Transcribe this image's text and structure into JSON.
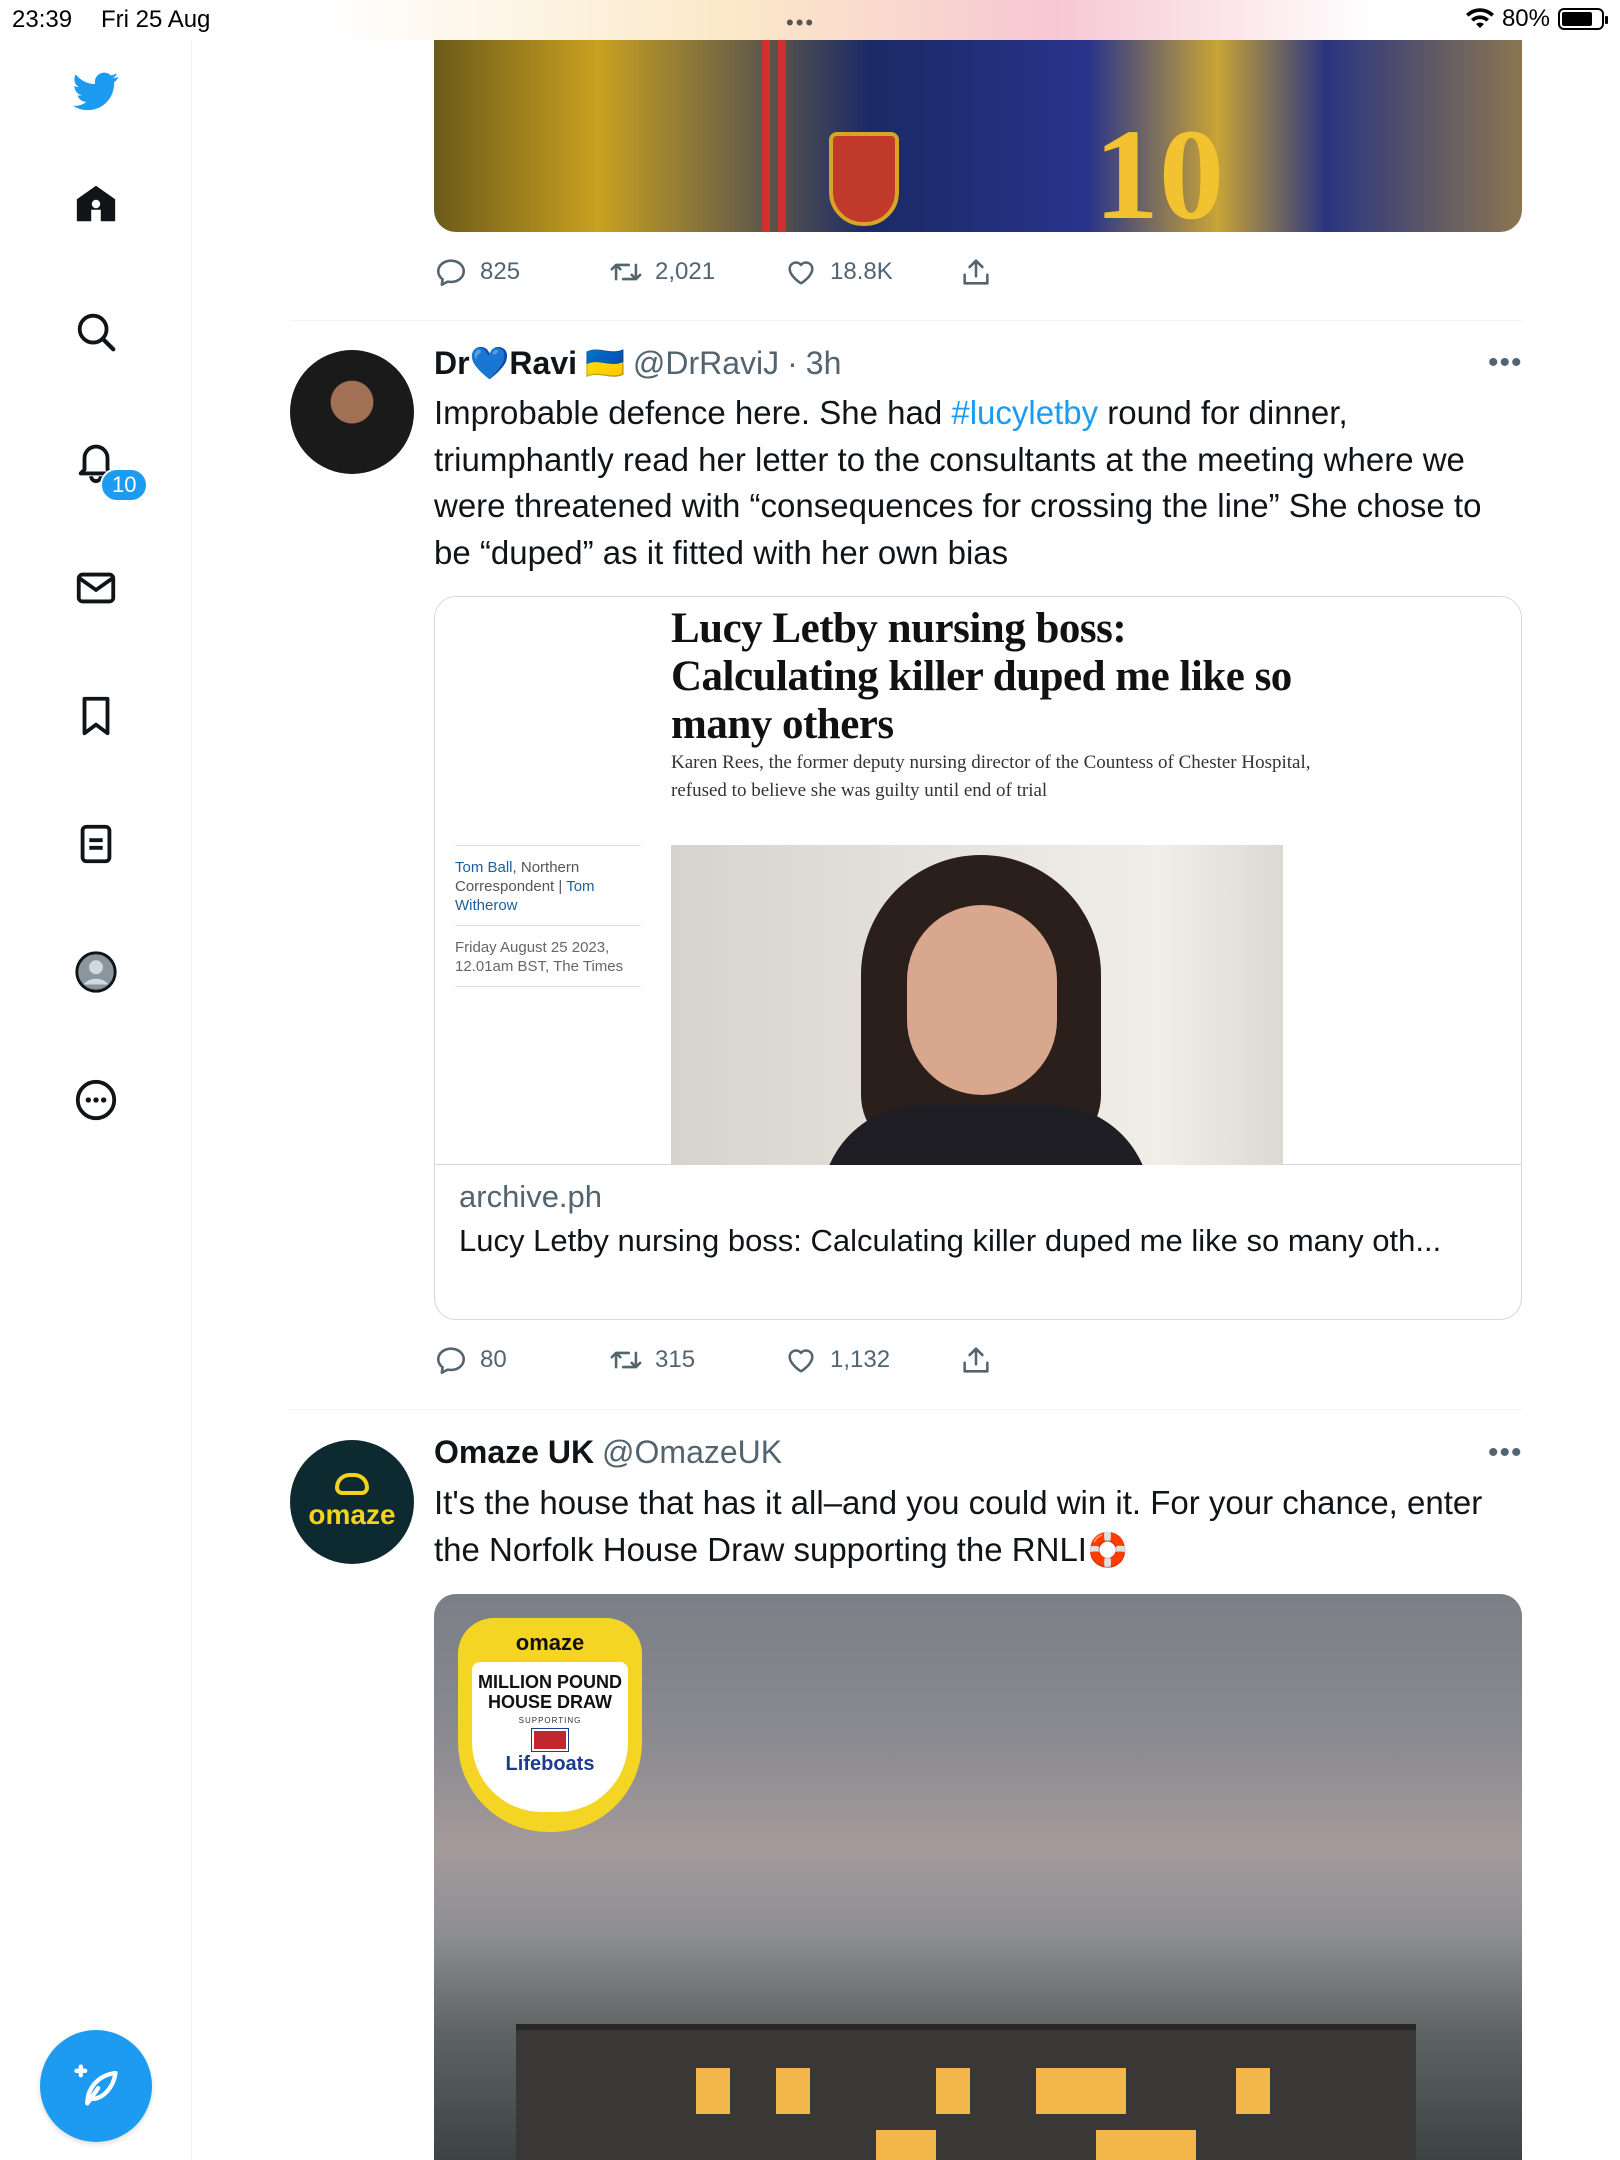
{
  "status_bar": {
    "time": "23:39",
    "date": "Fri 25 Aug",
    "battery": "80%",
    "battery_level": 0.8
  },
  "sidebar": {
    "notifications_badge": "10",
    "items": [
      {
        "name": "twitter-logo-icon"
      },
      {
        "name": "home-icon"
      },
      {
        "name": "search-icon"
      },
      {
        "name": "notifications-icon"
      },
      {
        "name": "messages-icon"
      },
      {
        "name": "bookmarks-icon"
      },
      {
        "name": "lists-icon"
      },
      {
        "name": "profile-icon"
      },
      {
        "name": "more-icon"
      }
    ],
    "compose_icon": "compose-tweet-icon"
  },
  "previous_tweet": {
    "actions": {
      "replies": "825",
      "retweets": "2,021",
      "likes": "18.8K"
    }
  },
  "tweet1": {
    "name_part1": "Dr",
    "name_heart": "💙",
    "name_part2": "Ravi",
    "flag": "🇺🇦",
    "handle": "@DrRaviJ",
    "separator": "·",
    "time": "3h",
    "text_before": "Improbable defence here. She had ",
    "hashtag": "#lucyletby",
    "text_after": " round for dinner, triumphantly read her letter to the consultants at the meeting where we were threatened with “consequences for crossing the line” She chose to be “duped” as it fitted with her own bias",
    "card": {
      "article_headline": "Lucy Letby nursing boss: Calculating killer duped me like so many others",
      "article_standfirst": "Karen Rees, the former deputy nursing director of the Countess of Chester Hospital, refused to believe she was guilty until end of trial",
      "byline_author1": "Tom Ball",
      "byline_role": ", Northern Correspondent | ",
      "byline_author2": "Tom Witherow",
      "dateline": "Friday August 25 2023, 12.01am BST, The Times",
      "domain": "archive.ph",
      "title": "Lucy Letby nursing boss: Calculating killer duped me like so many oth..."
    },
    "actions": {
      "replies": "80",
      "retweets": "315",
      "likes": "1,132"
    }
  },
  "tweet2": {
    "name": "Omaze UK",
    "handle": "@OmazeUK",
    "avatar_word": "omaze",
    "text": "It's the house that has it all–and you could win it. For your chance, enter the Norfolk House Draw supporting the RNLI🛟",
    "promo": {
      "brand": "omaze",
      "line1": "MILLION POUND",
      "line2": "HOUSE DRAW",
      "supporting": "SUPPORTING",
      "partner": "Lifeboats"
    }
  },
  "colors": {
    "accent": "#1d9bf0",
    "text_secondary": "#536471",
    "divider": "#eff3f4",
    "omaze_yellow": "#f4d21f",
    "omaze_dark": "#0c2a2f"
  }
}
